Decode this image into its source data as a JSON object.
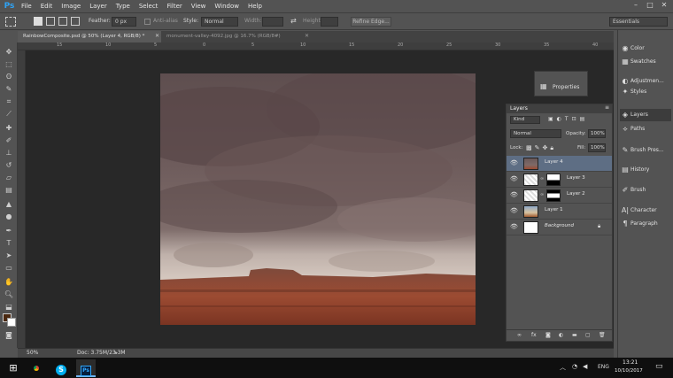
{
  "app": {
    "logo": "Ps"
  },
  "menu": [
    "File",
    "Edit",
    "Image",
    "Layer",
    "Type",
    "Select",
    "Filter",
    "View",
    "Window",
    "Help"
  ],
  "options": {
    "feather_label": "Feather:",
    "feather_value": "0 px",
    "antialias": "Anti-alias",
    "style_label": "Style:",
    "style_value": "Normal",
    "width_label": "Width:",
    "height_label": "Height:",
    "refine": "Refine Edge...",
    "workspace": "Essentials"
  },
  "tabs": [
    {
      "label": "RainbowComposite.psd @ 50% (Layer 4, RGB/8) *"
    },
    {
      "label": "monument-valley-4092.jpg @ 16.7% (RGB/8#)"
    }
  ],
  "ruler": [
    "15",
    "10",
    "5",
    "0",
    "5",
    "10",
    "15",
    "20",
    "25",
    "30",
    "35",
    "40"
  ],
  "status": {
    "zoom": "50%",
    "doc": "Doc: 3.75M/23.3M"
  },
  "properties": {
    "label": "Properties"
  },
  "layers": {
    "title": "Layers",
    "kind": "Kind",
    "blend": "Normal",
    "opacity_label": "Opacity:",
    "opacity": "100%",
    "lock_label": "Lock:",
    "fill_label": "Fill:",
    "fill": "100%",
    "items": [
      {
        "name": "Layer 4"
      },
      {
        "name": "Layer 3"
      },
      {
        "name": "Layer 2"
      },
      {
        "name": "Layer 1"
      },
      {
        "name": "Background"
      }
    ]
  },
  "dock": [
    "Color",
    "Swatches",
    "Adjustmen...",
    "Styles",
    "Layers",
    "Paths",
    "Brush Pres...",
    "History",
    "Brush",
    "Character",
    "Paragraph"
  ],
  "taskbar": {
    "lang": "ENG",
    "time": "13:21",
    "date": "10/10/2017"
  }
}
